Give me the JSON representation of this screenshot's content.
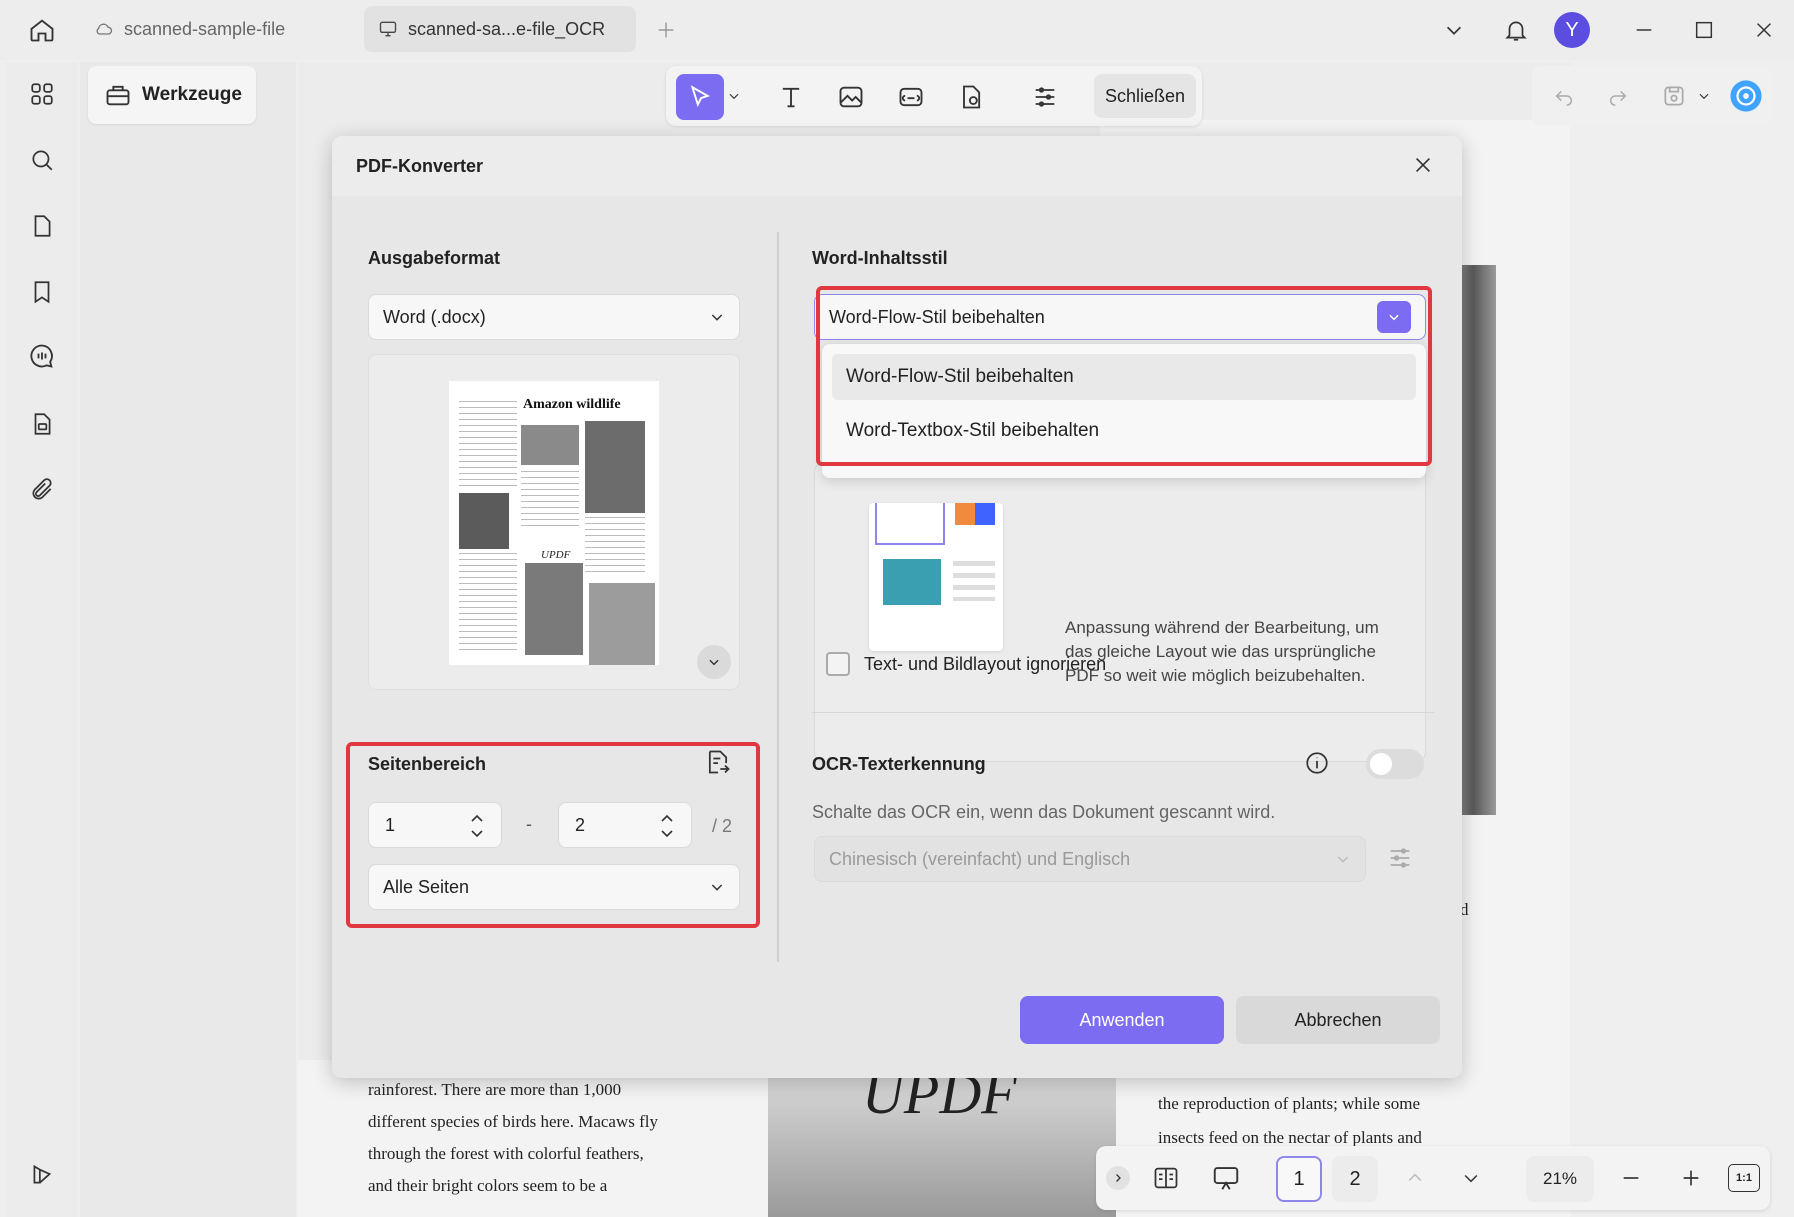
{
  "tabs": [
    {
      "label": "scanned-sample-file",
      "active": false
    },
    {
      "label": "scanned-sa...e-file_OCR",
      "active": true
    }
  ],
  "user": {
    "avatar_letter": "Y"
  },
  "tools_panel": {
    "label": "Werkzeuge"
  },
  "edit_toolbar": {
    "close_label": "Schließen"
  },
  "dialog": {
    "title": "PDF-Konverter",
    "output_format": {
      "label": "Ausgabeformat",
      "value": "Word (.docx)"
    },
    "preview": {
      "title": "Amazon wildlife",
      "watermark": "UPDF"
    },
    "page_range": {
      "label": "Seitenbereich",
      "from": "1",
      "to": "2",
      "total": "/ 2",
      "separator": "-",
      "subset": "Alle Seiten"
    },
    "word_style": {
      "label": "Word-Inhaltsstil",
      "value": "Word-Flow-Stil beibehalten",
      "options": [
        "Word-Flow-Stil beibehalten",
        "Word-Textbox-Stil beibehalten"
      ],
      "description": "Anpassung während der Bearbeitung, um das gleiche Layout wie das ursprüngliche PDF so weit wie möglich beizubehalten."
    },
    "ignore_layout": {
      "label": "Text- und Bildlayout ignorieren",
      "checked": false
    },
    "ocr": {
      "label": "OCR-Texterkennung",
      "enabled": false,
      "hint": "Schalte das OCR ein, wenn das Dokument gescannt wird.",
      "language": "Chinesisch (vereinfacht) und Englisch"
    },
    "apply_label": "Anwenden",
    "cancel_label": "Abbrechen"
  },
  "document_text": {
    "left_lines": [
      "rainforest. There are more than 1,000",
      "different species of birds here. Macaws fly",
      "through the forest with colorful feathers,",
      "and their bright colors seem to be a"
    ],
    "right_lines": [
      "the reproduction of plants; while some",
      "insects feed on the nectar of plants and"
    ],
    "right_fragment": "d",
    "center_watermark": "UPDF"
  },
  "bottom_bar": {
    "pages": [
      "1",
      "2"
    ],
    "current_page": "1",
    "zoom": "21%",
    "fit_label": "1:1"
  },
  "colors": {
    "accent": "#7b6cf2",
    "highlight": "#e0383e"
  }
}
